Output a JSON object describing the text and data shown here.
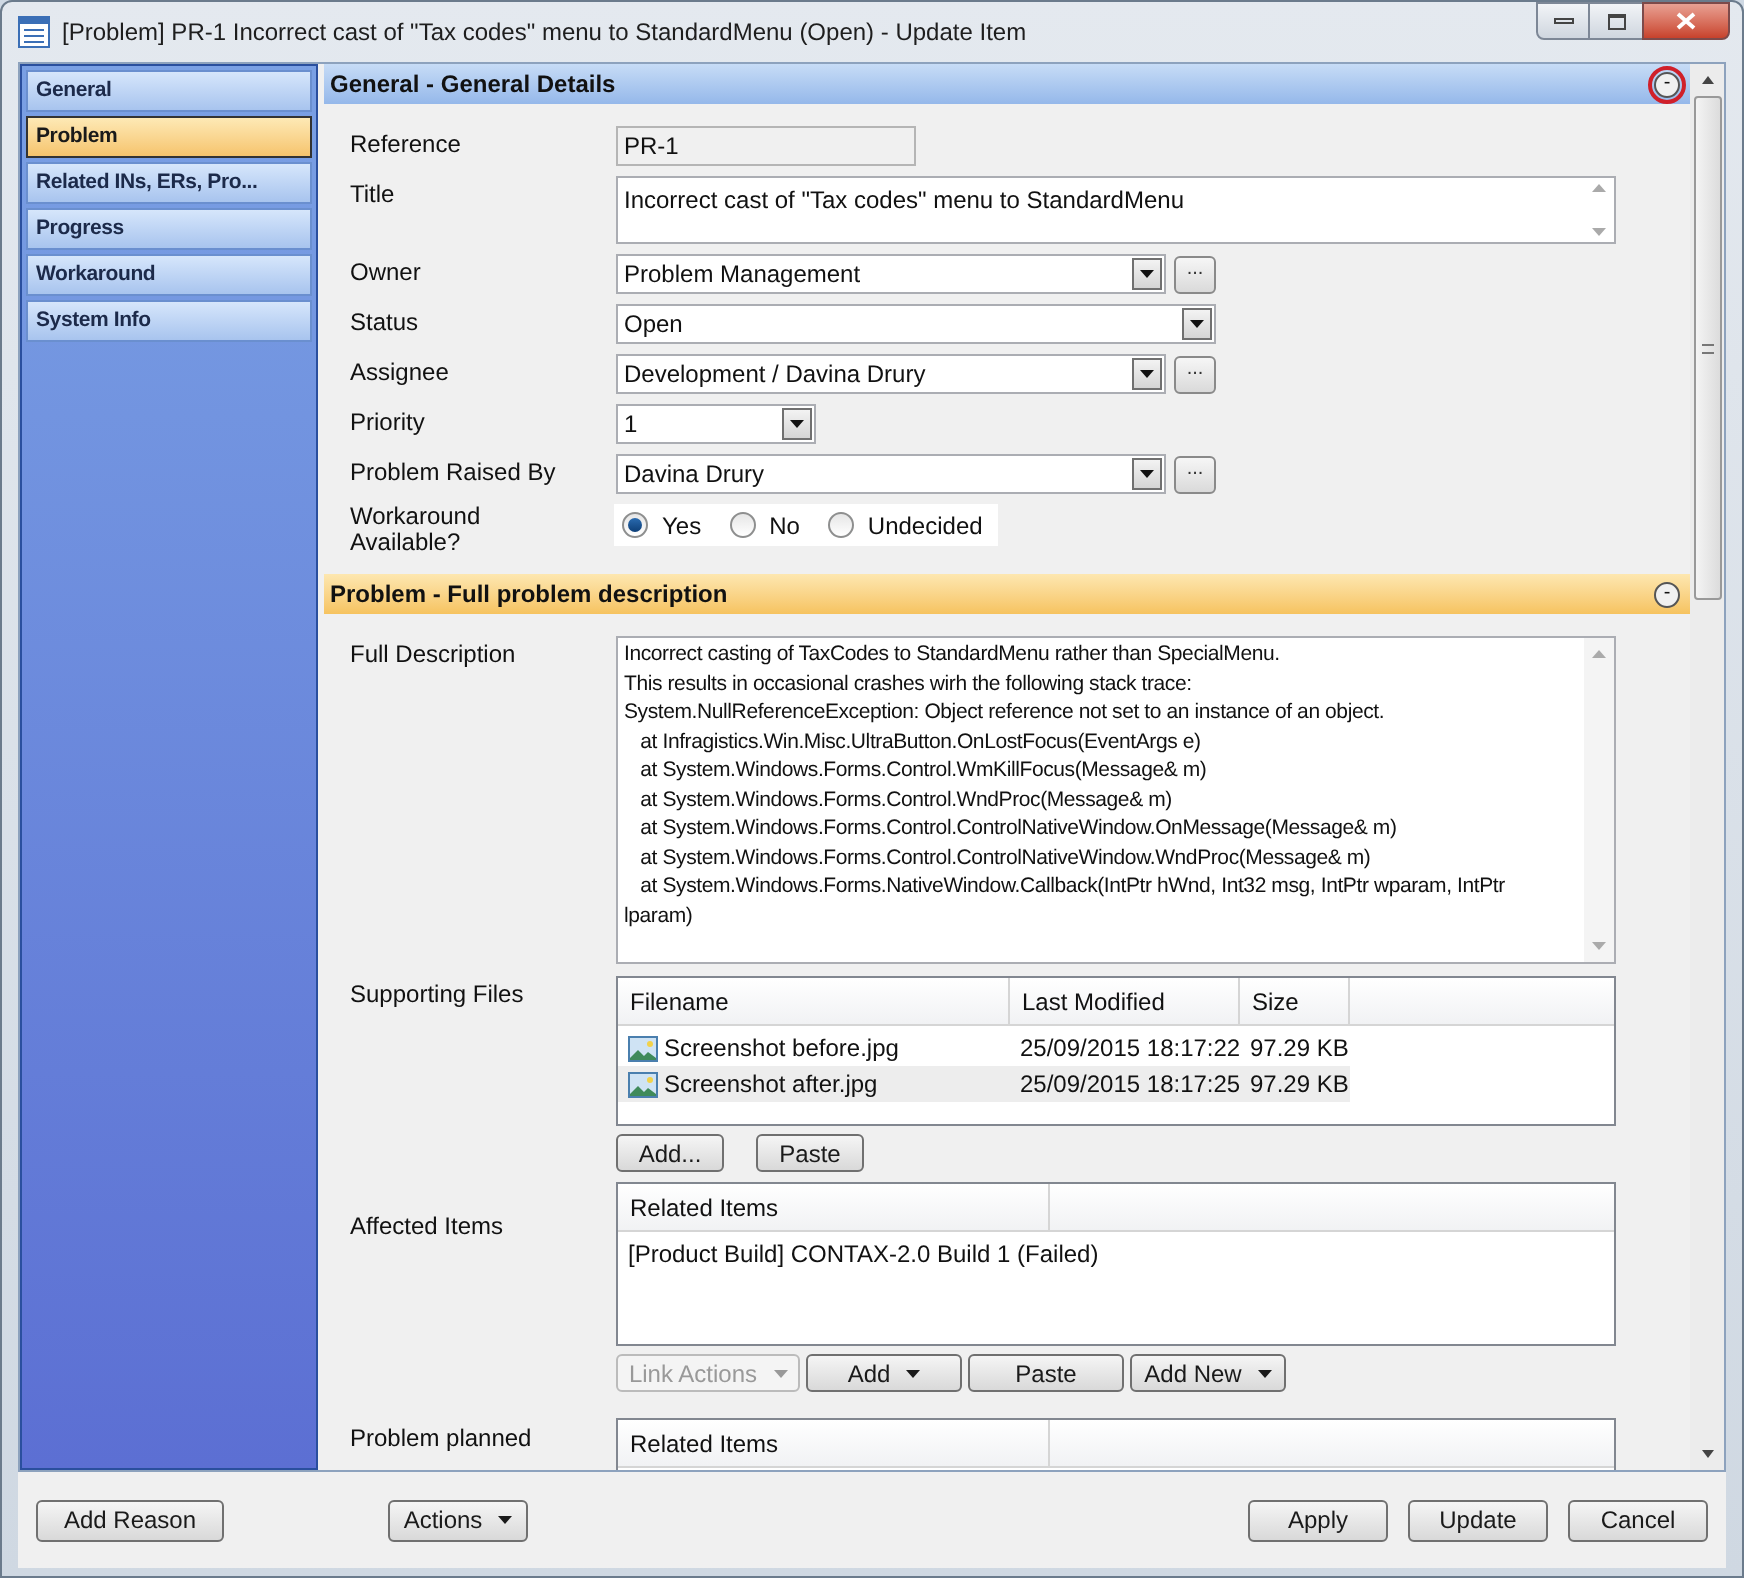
{
  "window": {
    "title": "[Problem] PR-1 Incorrect cast of \"Tax codes\" menu to StandardMenu (Open) - Update Item"
  },
  "sidebar": {
    "items": [
      {
        "label": "General",
        "selected": false
      },
      {
        "label": "Problem",
        "selected": true
      },
      {
        "label": "Related INs, ERs, Pro...",
        "selected": false
      },
      {
        "label": "Progress",
        "selected": false
      },
      {
        "label": "Workaround",
        "selected": false
      },
      {
        "label": "System Info",
        "selected": false
      }
    ]
  },
  "sections": [
    {
      "title": "General - General Details",
      "selected": false,
      "collapse_marked": true,
      "collapse_label": "-",
      "fields": [
        {
          "kind": "readonly",
          "label": "Reference",
          "value": "PR-1"
        },
        {
          "kind": "multiline",
          "label": "Title",
          "value": "Incorrect cast of \"Tax codes\" menu to StandardMenu"
        },
        {
          "kind": "combo",
          "label": "Owner",
          "value": "Problem Management",
          "browse": "..."
        },
        {
          "kind": "combo",
          "label": "Status",
          "value": "Open"
        },
        {
          "kind": "combo",
          "label": "Assignee",
          "value": "Development / Davina Drury",
          "browse": "..."
        },
        {
          "kind": "small_combo",
          "label": "Priority",
          "value": "1"
        },
        {
          "kind": "combo",
          "label": "Problem Raised By",
          "value": "Davina Drury",
          "browse": "..."
        },
        {
          "kind": "radio",
          "label": "Workaround Available?",
          "options": [
            {
              "label": "Yes",
              "selected": true
            },
            {
              "label": "No",
              "selected": false
            },
            {
              "label": "Undecided",
              "selected": false
            }
          ]
        }
      ]
    },
    {
      "title": "Problem - Full problem description",
      "selected": true,
      "collapse_marked": false,
      "collapse_label": "-",
      "fields": [
        {
          "kind": "description",
          "label": "Full Description",
          "value": "Incorrect casting of TaxCodes to StandardMenu rather than SpecialMenu.\nThis results in occasional crashes wirh the following stack trace:\nSystem.NullReferenceException: Object reference not set to an instance of an object.\n   at Infragistics.Win.Misc.UltraButton.OnLostFocus(EventArgs e)\n   at System.Windows.Forms.Control.WmKillFocus(Message& m)\n   at System.Windows.Forms.Control.WndProc(Message& m)\n   at System.Windows.Forms.Control.ControlNativeWindow.OnMessage(Message& m)\n   at System.Windows.Forms.Control.ControlNativeWindow.WndProc(Message& m)\n   at System.Windows.Forms.NativeWindow.Callback(IntPtr hWnd, Int32 msg, IntPtr wparam, IntPtr\nlparam)"
        },
        {
          "kind": "files",
          "label": "Supporting Files",
          "columns": [
            "Filename",
            "Last Modified",
            "Size"
          ],
          "rows": [
            {
              "cells": [
                "Screenshot before.jpg",
                "25/09/2015 18:17:22",
                "97.29 KB"
              ],
              "selected": false
            },
            {
              "cells": [
                "Screenshot after.jpg",
                "25/09/2015 18:17:25",
                "97.29 KB"
              ],
              "selected": true
            }
          ],
          "buttons": [
            {
              "label": "Add...",
              "dropdown": false,
              "disabled": false
            },
            {
              "label": "Paste",
              "dropdown": false,
              "disabled": false
            }
          ]
        },
        {
          "kind": "related",
          "label": "Affected Items",
          "columns": [
            "Related Items"
          ],
          "rows": [
            {
              "cells": [
                "[Product Build] CONTAX-2.0 Build 1 (Failed)"
              ],
              "selected": false
            }
          ],
          "buttons": [
            {
              "label": "Link Actions",
              "dropdown": true,
              "disabled": true
            },
            {
              "label": "Add",
              "dropdown": true,
              "disabled": false
            },
            {
              "label": "Paste",
              "dropdown": false,
              "disabled": false
            },
            {
              "label": "Add New",
              "dropdown": true,
              "disabled": false
            }
          ]
        },
        {
          "kind": "related_cut",
          "label": "Problem planned",
          "columns": [
            "Related Items"
          ]
        }
      ]
    }
  ],
  "footer": {
    "left": [
      {
        "label": "Add Reason",
        "dropdown": false
      },
      {
        "label": "Actions",
        "dropdown": true
      }
    ],
    "right": [
      {
        "label": "Apply",
        "dropdown": false
      },
      {
        "label": "Update",
        "dropdown": false
      },
      {
        "label": "Cancel",
        "dropdown": false
      }
    ]
  }
}
